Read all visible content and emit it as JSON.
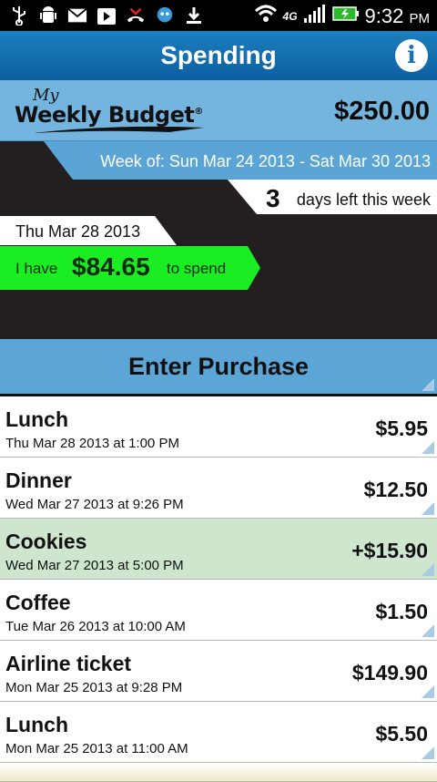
{
  "status_bar": {
    "time": "9:32",
    "ampm": "PM",
    "network": "4G",
    "icons": [
      "usb-icon",
      "android-debug-icon",
      "mail-icon",
      "play-store-icon",
      "missed-call-icon",
      "chat-icon",
      "download-icon",
      "wifi-icon",
      "signal-icon",
      "battery-charging-icon"
    ]
  },
  "header": {
    "title": "Spending",
    "info_icon": "i"
  },
  "budget": {
    "logo_my": "My",
    "logo_name": "Weekly Budget",
    "logo_mark": "®",
    "amount": "$250.00"
  },
  "week": {
    "range": "Week of: Sun Mar 24 2013 - Sat Mar 30 2013",
    "days_left_num": "3",
    "days_left_text": "days left this week",
    "current_date": "Thu Mar 28 2013",
    "have_prefix": "I have",
    "have_amount": "$84.65",
    "have_suffix": "to spend"
  },
  "enter_purchase": {
    "label": "Enter Purchase"
  },
  "purchases": [
    {
      "name": "Lunch",
      "datetime": "Thu Mar 28 2013  at  1:00 PM",
      "amount": "$5.95",
      "credit": false
    },
    {
      "name": "Dinner",
      "datetime": "Wed Mar 27 2013  at  9:26 PM",
      "amount": "$12.50",
      "credit": false
    },
    {
      "name": "Cookies",
      "datetime": "Wed Mar 27 2013  at  5:00 PM",
      "amount": "+$15.90",
      "credit": true
    },
    {
      "name": "Coffee",
      "datetime": "Tue Mar 26 2013  at  10:00 AM",
      "amount": "$1.50",
      "credit": false
    },
    {
      "name": "Airline ticket",
      "datetime": "Mon Mar 25 2013  at  9:28 PM",
      "amount": "$149.90",
      "credit": false
    },
    {
      "name": "Lunch",
      "datetime": "Mon Mar 25 2013  at  11:00 AM",
      "amount": "$5.50",
      "credit": false
    }
  ],
  "colors": {
    "header": "#0c5fa1",
    "accent_blue": "#5ca6d7",
    "green": "#1aee22",
    "credit_row": "#cde6cd",
    "dark": "#231f20"
  }
}
